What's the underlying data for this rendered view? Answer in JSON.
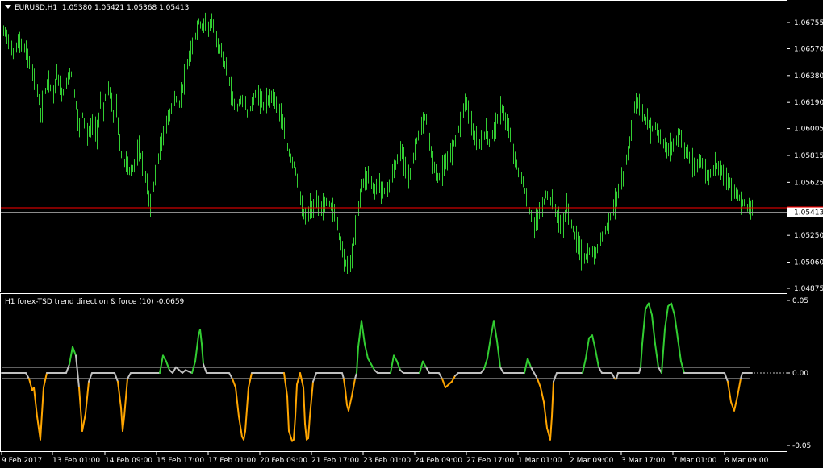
{
  "main_chart": {
    "symbol_label": "EURUSD,H1",
    "ohlc_label": "1.05380 1.05421 1.05368 1.05413",
    "current_price": "1.05413",
    "price_ticks": [
      "1.06755",
      "1.06570",
      "1.06380",
      "1.06190",
      "1.06005",
      "1.05815",
      "1.05625",
      "1.05250",
      "1.05060",
      "1.04875"
    ],
    "y_range": [
      1.04875,
      1.06755
    ],
    "red_line_price": 1.05445,
    "bar_color": "#32cd32",
    "red_line_color": "#ff0000"
  },
  "indicator": {
    "label": "H1 forex-TSD trend direction & force (10) -0.0659",
    "ticks": [
      "0.05",
      "0.00",
      "-0.05"
    ],
    "y_range": [
      -0.05,
      0.05
    ],
    "pos_color": "#32cd32",
    "neg_color": "#ffa500",
    "neutral_color": "#c0c0c0"
  },
  "time_axis": {
    "labels": [
      "9 Feb 2017",
      "13 Feb 01:00",
      "14 Feb 09:00",
      "15 Feb 17:00",
      "17 Feb 01:00",
      "20 Feb 09:00",
      "21 Feb 17:00",
      "23 Feb 01:00",
      "24 Feb 09:00",
      "27 Feb 17:00",
      "1 Mar 01:00",
      "2 Mar 09:00",
      "3 Mar 17:00",
      "7 Mar 01:00",
      "8 Mar 09:00"
    ]
  },
  "chart_data": {
    "type": "line",
    "price_path": {
      "x": [
        0,
        5,
        10,
        15,
        20,
        30,
        38,
        45,
        48,
        55,
        58,
        63,
        68,
        74,
        80,
        85,
        90,
        96,
        100,
        106,
        112,
        118,
        122,
        126,
        130,
        134,
        138,
        142,
        146,
        150,
        155,
        158,
        162,
        166,
        170,
        175,
        180,
        184,
        188,
        192,
        196,
        200,
        205,
        210,
        215,
        220,
        224,
        228,
        232,
        236,
        240,
        244,
        248,
        252,
        256,
        260,
        264,
        268,
        272,
        276,
        280,
        285,
        290,
        295,
        300,
        305,
        310,
        315,
        320,
        325,
        330,
        335,
        340,
        345,
        350,
        355,
        358,
        362,
        366,
        370,
        374,
        378,
        382,
        386,
        390,
        395,
        400,
        405,
        410,
        415,
        418,
        422,
        426,
        430,
        434,
        438,
        442,
        446,
        450,
        454,
        458,
        462,
        466,
        470,
        475,
        480,
        485,
        490,
        495,
        500,
        505,
        510,
        515,
        520,
        525,
        530,
        535,
        540,
        545,
        550,
        555,
        560,
        565,
        570,
        575,
        580,
        585,
        590,
        595,
        600,
        605,
        610,
        615,
        620,
        625,
        630,
        635,
        640,
        645,
        650,
        655,
        660,
        665,
        670,
        675,
        680,
        685,
        690,
        695,
        700,
        705,
        710,
        715,
        720,
        725,
        730,
        735,
        740,
        745,
        750,
        755,
        760,
        765,
        770,
        775,
        780,
        784,
        788,
        792,
        796,
        800,
        805,
        810,
        815,
        820,
        825,
        830,
        835,
        840,
        845,
        850,
        855,
        860,
        865,
        870,
        875,
        880,
        885,
        890,
        895,
        900,
        905,
        910,
        915,
        920,
        925,
        930
      ],
      "y": [
        1.0671,
        1.0668,
        1.066,
        1.0652,
        1.0662,
        1.0655,
        1.064,
        1.0625,
        1.061,
        1.063,
        1.0636,
        1.062,
        1.064,
        1.0624,
        1.0633,
        1.0642,
        1.0625,
        1.06,
        1.061,
        1.0596,
        1.0603,
        1.0597,
        1.062,
        1.0612,
        1.0633,
        1.0625,
        1.061,
        1.0616,
        1.059,
        1.0575,
        1.0578,
        1.057,
        1.0572,
        1.0578,
        1.0585,
        1.0575,
        1.056,
        1.0545,
        1.056,
        1.0575,
        1.0585,
        1.0595,
        1.0605,
        1.0615,
        1.0622,
        1.0618,
        1.063,
        1.064,
        1.065,
        1.0657,
        1.0666,
        1.0676,
        1.0672,
        1.0677,
        1.0672,
        1.0675,
        1.067,
        1.066,
        1.0655,
        1.0645,
        1.064,
        1.0625,
        1.0612,
        1.062,
        1.0622,
        1.061,
        1.0618,
        1.0627,
        1.0622,
        1.0615,
        1.062,
        1.0625,
        1.0618,
        1.0612,
        1.0598,
        1.0585,
        1.058,
        1.0575,
        1.0565,
        1.055,
        1.054,
        1.0535,
        1.0545,
        1.0541,
        1.055,
        1.0543,
        1.0547,
        1.0549,
        1.0543,
        1.0538,
        1.0525,
        1.0515,
        1.0505,
        1.0502,
        1.051,
        1.053,
        1.0545,
        1.056,
        1.0565,
        1.0567,
        1.0562,
        1.0555,
        1.0565,
        1.0558,
        1.0555,
        1.056,
        1.057,
        1.0578,
        1.0585,
        1.0575,
        1.0565,
        1.058,
        1.0595,
        1.06,
        1.061,
        1.059,
        1.0575,
        1.0565,
        1.057,
        1.0575,
        1.058,
        1.059,
        1.0597,
        1.061,
        1.062,
        1.061,
        1.0595,
        1.0588,
        1.0592,
        1.0598,
        1.059,
        1.06,
        1.061,
        1.0615,
        1.0605,
        1.0595,
        1.058,
        1.057,
        1.0565,
        1.055,
        1.054,
        1.053,
        1.054,
        1.0545,
        1.0555,
        1.055,
        1.0545,
        1.0535,
        1.053,
        1.0545,
        1.0535,
        1.0525,
        1.0518,
        1.0508,
        1.051,
        1.0515,
        1.051,
        1.052,
        1.0525,
        1.0532,
        1.054,
        1.0548,
        1.0558,
        1.0565,
        1.058,
        1.06,
        1.0615,
        1.062,
        1.0615,
        1.0608,
        1.0605,
        1.06,
        1.0602,
        1.0595,
        1.059,
        1.0585,
        1.0588,
        1.059,
        1.0598,
        1.0585,
        1.0583,
        1.0576,
        1.057,
        1.058,
        1.0574,
        1.0566,
        1.057,
        1.0575,
        1.0573,
        1.0568,
        1.0562,
        1.056,
        1.0555,
        1.055,
        1.0548,
        1.0545,
        1.0543,
        1.0541
      ]
    },
    "indicator_path": {
      "x": [
        0,
        10,
        20,
        30,
        34,
        38,
        40,
        44,
        48,
        52,
        56,
        60,
        64,
        68,
        72,
        76,
        80,
        84,
        88,
        92,
        96,
        100,
        104,
        108,
        112,
        116,
        120,
        124,
        128,
        132,
        136,
        140,
        144,
        148,
        150,
        152,
        156,
        160,
        164,
        168,
        172,
        176,
        180,
        184,
        188,
        192,
        196,
        200,
        204,
        208,
        212,
        216,
        220,
        224,
        228,
        232,
        236,
        240,
        244,
        246,
        248,
        250,
        254,
        258,
        262,
        266,
        270,
        274,
        278,
        282,
        286,
        290,
        294,
        298,
        300,
        302,
        306,
        310,
        314,
        318,
        322,
        326,
        330,
        334,
        338,
        342,
        346,
        350,
        354,
        356,
        360,
        362,
        364,
        366,
        370,
        374,
        376,
        378,
        380,
        382,
        386,
        390,
        394,
        398,
        402,
        406,
        410,
        414,
        418,
        422,
        424,
        426,
        428,
        430,
        434,
        438,
        440,
        442,
        446,
        450,
        454,
        458,
        462,
        466,
        470,
        474,
        478,
        482,
        486,
        490,
        494,
        498,
        502,
        506,
        510,
        514,
        518,
        522,
        526,
        530,
        534,
        538,
        542,
        546,
        550,
        554,
        558,
        562,
        566,
        570,
        574,
        578,
        582,
        584,
        586,
        590,
        594,
        598,
        602,
        606,
        610,
        614,
        618,
        622,
        626,
        630,
        634,
        638,
        640,
        642,
        644,
        646,
        648,
        652,
        656,
        660,
        664,
        668,
        672,
        676,
        680,
        682,
        684,
        688,
        692,
        696,
        700,
        704,
        708,
        712,
        716,
        720,
        724,
        728,
        732,
        736,
        740,
        744,
        748,
        752,
        756,
        760,
        762,
        764,
        766,
        768,
        770,
        772,
        774,
        776,
        778,
        780,
        782,
        784,
        786,
        788,
        790,
        792,
        794,
        798,
        802,
        806,
        810,
        814,
        818,
        822,
        826,
        830,
        834,
        838,
        842,
        846,
        850,
        852,
        854,
        856,
        858,
        860,
        864,
        868,
        872,
        876,
        880,
        884,
        888,
        892,
        896,
        900,
        904,
        908,
        912,
        916,
        918,
        920,
        922,
        924,
        926,
        928,
        930
      ],
      "y": [
        0.0,
        0.0,
        0.0,
        0.0,
        -0.004,
        -0.012,
        -0.01,
        -0.03,
        -0.046,
        -0.01,
        0.0,
        0.0,
        0.0,
        0.0,
        0.0,
        0.0,
        0.0,
        0.006,
        0.018,
        0.012,
        -0.01,
        -0.04,
        -0.028,
        -0.006,
        0.0,
        0.0,
        0.0,
        0.0,
        0.0,
        0.0,
        0.0,
        0.0,
        -0.006,
        -0.024,
        -0.04,
        -0.03,
        -0.004,
        0.0,
        0.0,
        0.0,
        0.0,
        0.0,
        0.0,
        0.0,
        0.0,
        0.0,
        0.0,
        0.012,
        0.008,
        0.002,
        0.0,
        0.004,
        0.002,
        0.0,
        0.002,
        0.001,
        0.0,
        0.008,
        0.026,
        0.03,
        0.02,
        0.006,
        0.0,
        0.0,
        0.0,
        0.0,
        0.0,
        0.0,
        0.0,
        0.0,
        -0.004,
        -0.01,
        -0.03,
        -0.044,
        -0.046,
        -0.04,
        -0.01,
        0.0,
        0.0,
        0.0,
        0.0,
        0.0,
        0.0,
        0.0,
        0.0,
        0.0,
        0.0,
        0.0,
        -0.016,
        -0.04,
        -0.047,
        -0.046,
        -0.03,
        -0.008,
        0.0,
        -0.01,
        -0.035,
        -0.046,
        -0.045,
        -0.03,
        -0.006,
        0.0,
        0.0,
        0.0,
        0.0,
        0.0,
        0.0,
        0.0,
        0.0,
        0.0,
        -0.004,
        -0.012,
        -0.022,
        -0.026,
        -0.016,
        -0.004,
        0.0,
        0.018,
        0.036,
        0.02,
        0.01,
        0.006,
        0.002,
        0.0,
        0.0,
        0.0,
        0.0,
        0.0,
        0.012,
        0.008,
        0.002,
        0.0,
        0.0,
        0.0,
        0.0,
        0.0,
        0.0,
        0.008,
        0.004,
        0.0,
        0.0,
        0.0,
        0.0,
        -0.004,
        -0.01,
        -0.008,
        -0.006,
        -0.002,
        0.0,
        0.0,
        0.0,
        0.0,
        0.0,
        0.0,
        0.0,
        0.0,
        0.0,
        0.003,
        0.01,
        0.024,
        0.036,
        0.022,
        0.004,
        0.0,
        0.0,
        0.0,
        0.0,
        0.0,
        0.0,
        0.0,
        0.0,
        0.0,
        0.0,
        0.01,
        0.004,
        0.0,
        -0.004,
        -0.01,
        -0.02,
        -0.038,
        -0.046,
        -0.03,
        -0.006,
        0.0,
        0.0,
        0.0,
        0.0,
        0.0,
        0.0,
        0.0,
        0.0,
        0.0,
        0.01,
        0.024,
        0.026,
        0.016,
        0.004,
        0.0,
        0.0,
        0.0,
        0.0,
        -0.004,
        -0.004,
        0.0,
        0.0,
        0.0,
        0.0,
        0.0,
        0.0,
        0.0,
        0.0,
        0.0,
        0.0,
        0.0,
        0.0,
        0.0,
        0.0,
        0.004,
        0.02,
        0.044,
        0.048,
        0.04,
        0.02,
        0.004,
        0.0,
        0.03,
        0.046,
        0.048,
        0.04,
        0.024,
        0.008,
        0.0,
        0.0,
        0.0,
        0.0,
        0.0,
        0.0,
        0.0,
        0.0,
        0.0,
        0.0,
        0.0,
        0.0,
        0.0,
        0.0,
        0.0,
        0.0,
        -0.006,
        -0.02,
        -0.026,
        -0.016,
        -0.004,
        0.0,
        0.0,
        0.0,
        0.0,
        0.0,
        0.0,
        0.0,
        0.0,
        0.0,
        0.0,
        0.0,
        -0.002,
        -0.008,
        -0.02,
        -0.04,
        -0.046,
        -0.042,
        -0.02,
        -0.006,
        -0.004
      ]
    },
    "title": "",
    "xlabel": "",
    "ylabel": "",
    "grid": false
  }
}
